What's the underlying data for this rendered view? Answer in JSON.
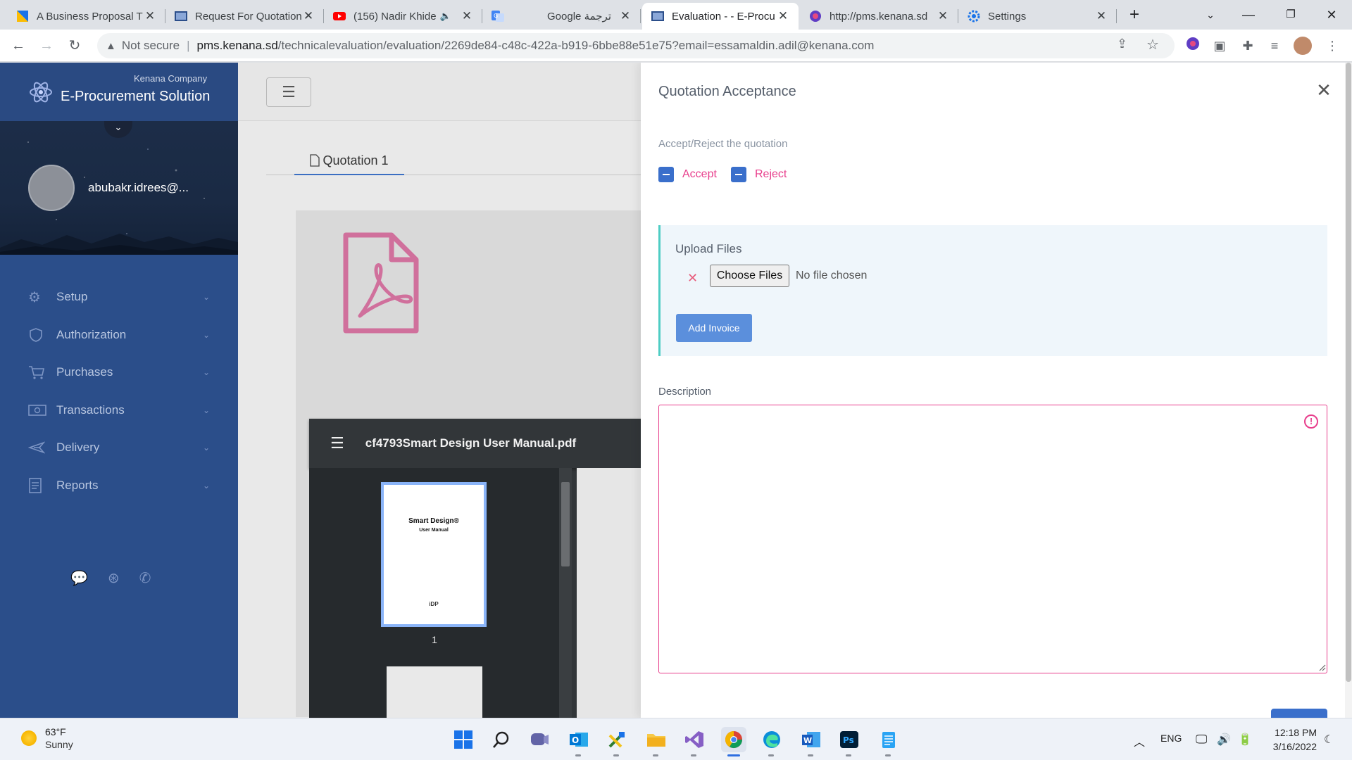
{
  "browser": {
    "tabs": [
      {
        "title": "A Business Proposal T",
        "icon": "slides-icon"
      },
      {
        "title": "Request For Quotation",
        "icon": "app-icon"
      },
      {
        "title": "(156) Nadir Khide",
        "icon": "youtube-icon"
      },
      {
        "title": "Google ترجمة",
        "icon": "translate-icon"
      },
      {
        "title": "Evaluation - - E-Procu",
        "icon": "app-icon",
        "active": true
      },
      {
        "title": "http://pms.kenana.sd",
        "icon": "globe-icon"
      },
      {
        "title": "Settings",
        "icon": "gear-icon"
      }
    ],
    "security_label": "Not secure",
    "url_host": "pms.kenana.sd",
    "url_path": "/technicalevaluation/evaluation/2269de84-c48c-422a-b919-6bbe88e51e75?email=essamaldin.adil@kenana.com"
  },
  "sidebar": {
    "company": "Kenana Company",
    "app_name": "E-Procurement Solution",
    "user": "abubakr.idrees@...",
    "menu": [
      {
        "label": "Setup",
        "icon": "gears-icon"
      },
      {
        "label": "Authorization",
        "icon": "shield-icon"
      },
      {
        "label": "Purchases",
        "icon": "cart-icon"
      },
      {
        "label": "Transactions",
        "icon": "money-icon"
      },
      {
        "label": "Delivery",
        "icon": "plane-icon"
      },
      {
        "label": "Reports",
        "icon": "report-icon"
      }
    ]
  },
  "main": {
    "tab_label": "Quotation 1",
    "pdf": {
      "filename": "cf4793Smart Design User Manual.pdf",
      "thumb_title": "Smart Design®",
      "thumb_subtitle": "User Manual",
      "thumb_logo": "iDP",
      "page_number": "1"
    }
  },
  "drawer": {
    "title": "Quotation Acceptance",
    "accept_reject_label": "Accept/Reject the quotation",
    "accept_label": "Accept",
    "reject_label": "Reject",
    "upload_title": "Upload Files",
    "choose_files_label": "Choose Files",
    "no_file_label": "No file chosen",
    "add_invoice_label": "Add Invoice",
    "description_label": "Description",
    "description_value": ""
  },
  "taskbar": {
    "temperature": "63°F",
    "condition": "Sunny",
    "language": "ENG",
    "time": "12:18 PM",
    "date": "3/16/2022"
  },
  "colors": {
    "sidebar": "#2b4e8a",
    "accent_pink": "#e83e8c",
    "primary_blue": "#3a6fcb",
    "upload_border": "#4ecdc4"
  }
}
